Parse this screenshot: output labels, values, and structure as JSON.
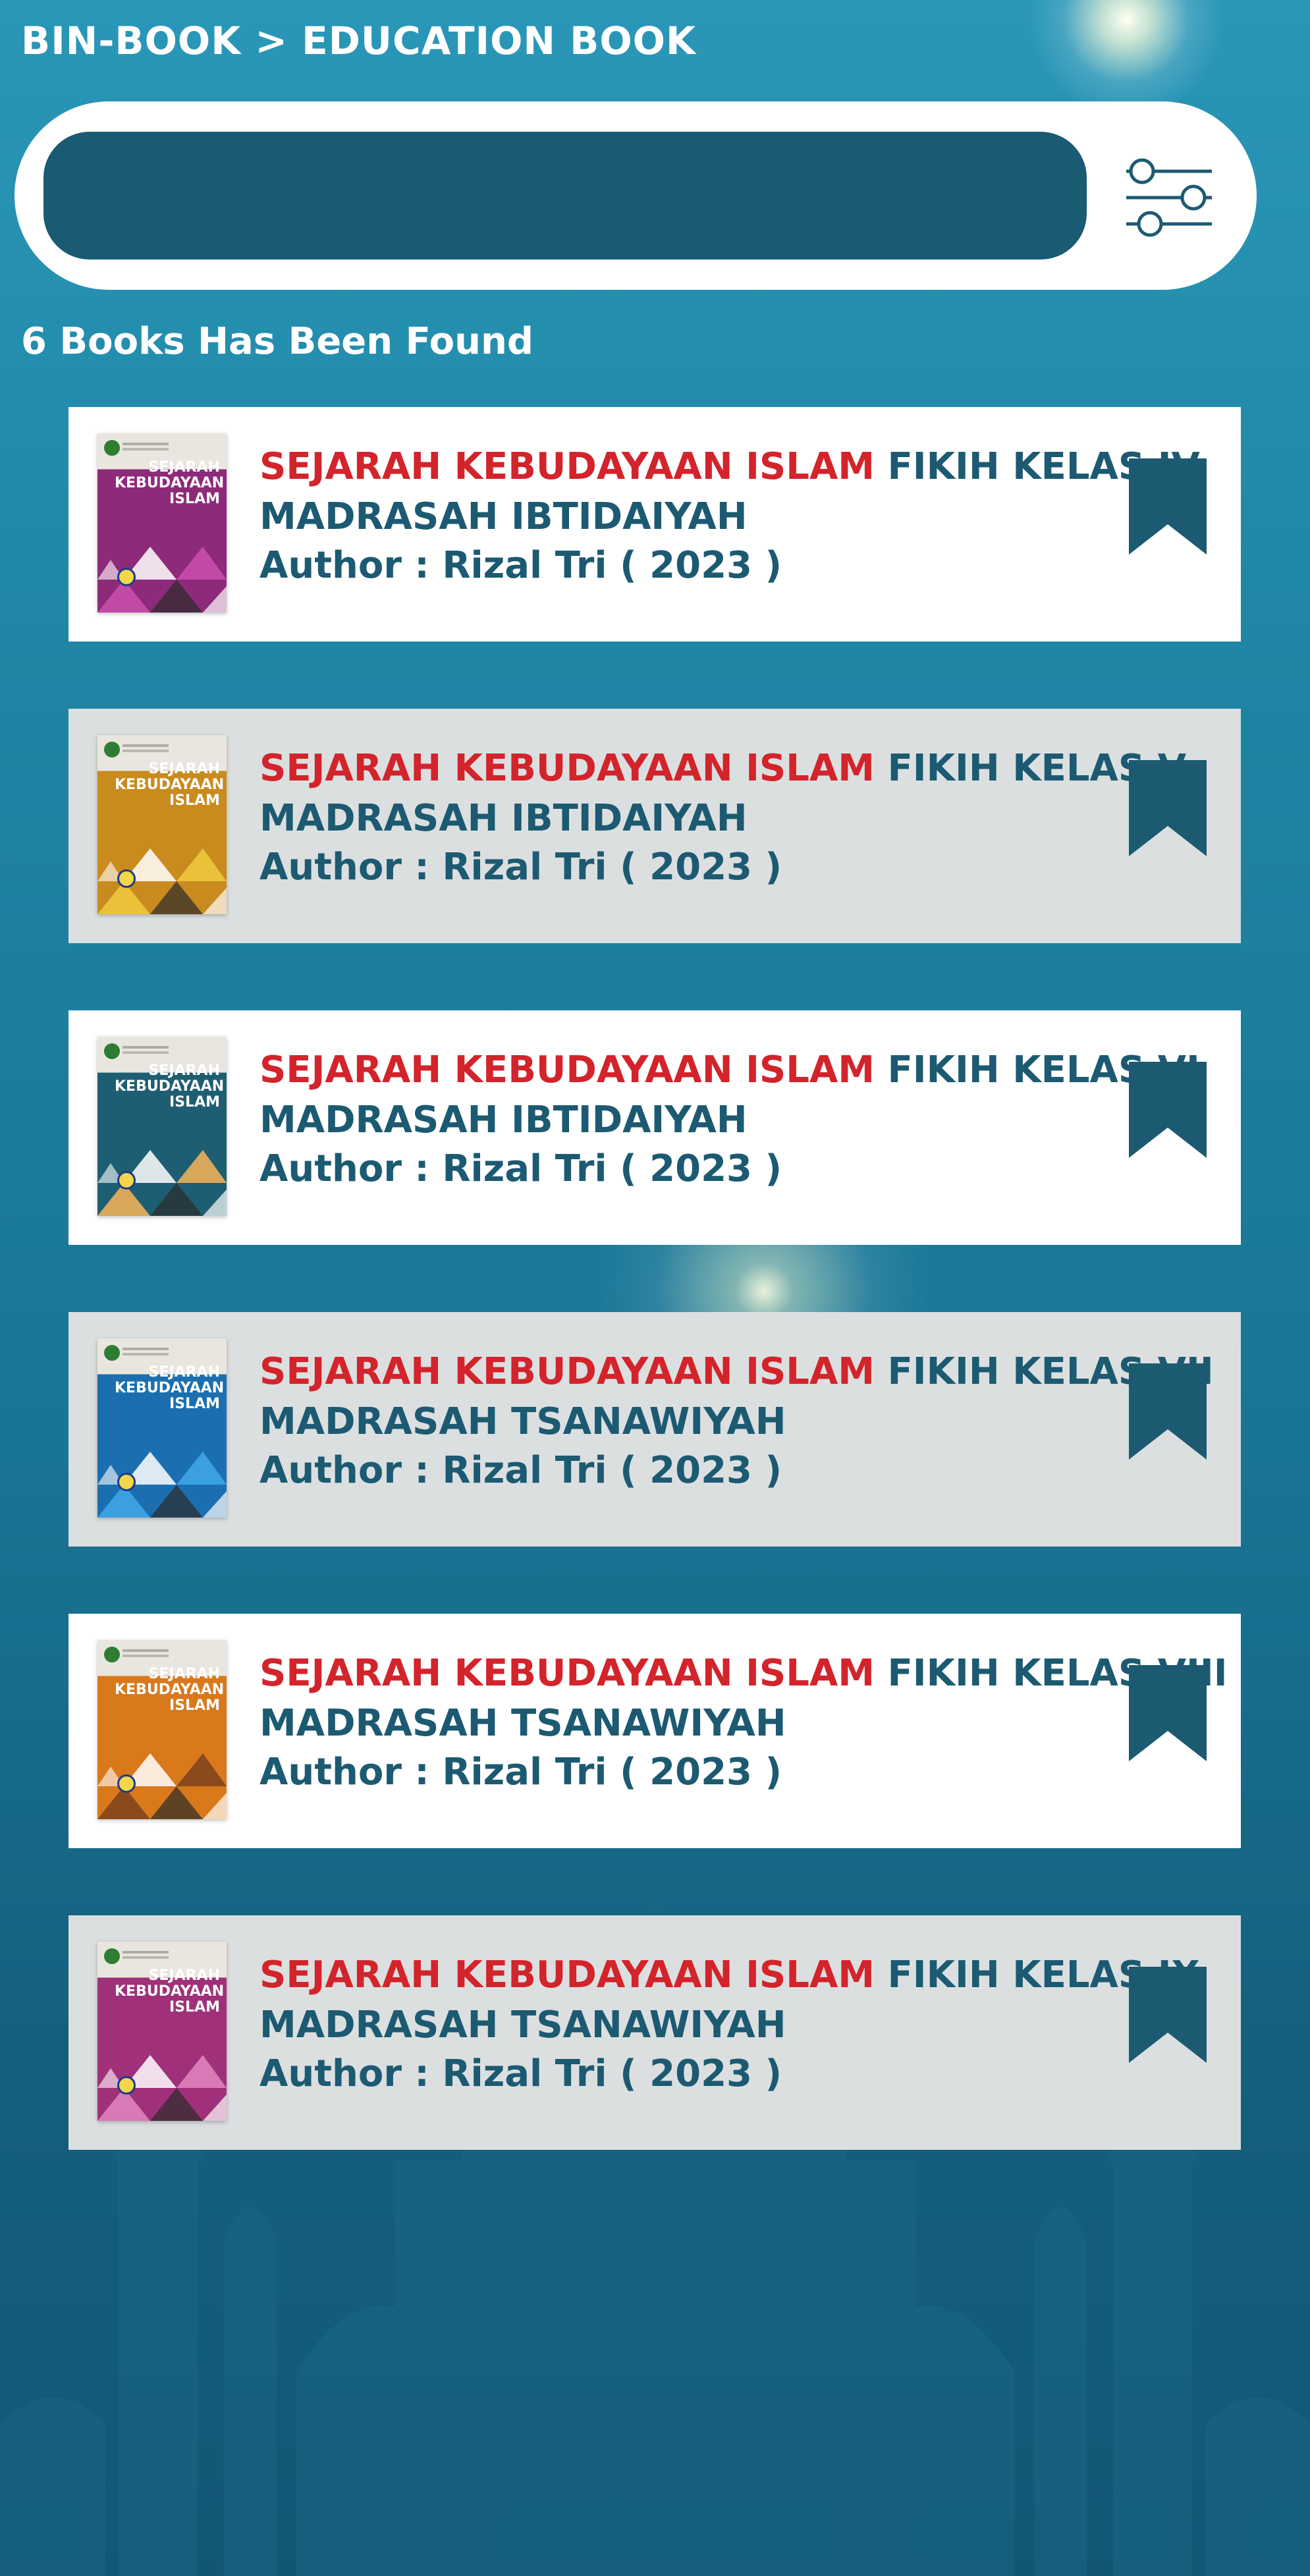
{
  "header": {
    "breadcrumb": "BIN-BOOK > EDUCATION BOOK"
  },
  "search": {
    "value": "",
    "placeholder": ""
  },
  "results": {
    "count_text": "6 Books Has Been Found"
  },
  "colors": {
    "accent_red": "#d3232b",
    "primary_teal": "#1c5a72",
    "search_field": "#185b72"
  },
  "books": [
    {
      "title_red": "SEJARAH KEBUDAYAAN ISLAM",
      "title_teal": "FIKIH KELAS IV",
      "level": "MADRASAH IBTIDAIYAH",
      "author": "Author : Rizal Tri ( 2023 )",
      "cover": {
        "text": [
          "SEJARAH",
          "KEBUDAYAAN",
          "ISLAM"
        ],
        "color": "#8e2a7a",
        "accent": "#c24aa6"
      }
    },
    {
      "title_red": "SEJARAH KEBUDAYAAN ISLAM",
      "title_teal": "FIKIH KELAS V",
      "level": "MADRASAH IBTIDAIYAH",
      "author": "Author : Rizal Tri ( 2023 )",
      "cover": {
        "text": [
          "SEJARAH",
          "KEBUDAYAAN",
          "ISLAM"
        ],
        "color": "#c98a1e",
        "accent": "#e9c23a"
      }
    },
    {
      "title_red": "SEJARAH KEBUDAYAAN ISLAM",
      "title_teal": "FIKIH KELAS VI",
      "level": "MADRASAH IBTIDAIYAH",
      "author": "Author : Rizal Tri ( 2023 )",
      "cover": {
        "text": [
          "SEJARAH",
          "KEBUDAYAAN",
          "ISLAM"
        ],
        "color": "#1e5e72",
        "accent": "#d9a75a"
      }
    },
    {
      "title_red": "SEJARAH KEBUDAYAAN ISLAM",
      "title_teal": "FIKIH KELAS VII",
      "level": "MADRASAH TSANAWIYAH",
      "author": "Author : Rizal Tri ( 2023 )",
      "cover": {
        "text": [
          "SEJARAH",
          "KEBUDAYAAN",
          "ISLAM"
        ],
        "color": "#1b6fb0",
        "accent": "#3aa0e0"
      }
    },
    {
      "title_red": "SEJARAH KEBUDAYAAN ISLAM",
      "title_teal": "FIKIH KELAS VIII",
      "level": "MADRASAH TSANAWIYAH",
      "author": "Author : Rizal Tri ( 2023 )",
      "cover": {
        "text": [
          "SEJARAH",
          "KEBUDAYAAN",
          "ISLAM"
        ],
        "color": "#d9791c",
        "accent": "#8a4a1c"
      }
    },
    {
      "title_red": "SEJARAH KEBUDAYAAN ISLAM",
      "title_teal": "FIKIH KELAS IX",
      "level": "MADRASAH TSANAWIYAH",
      "author": "Author : Rizal Tri ( 2023 )",
      "cover": {
        "text": [
          "SEJARAH",
          "KEBUDAYAAN",
          "ISLAM"
        ],
        "color": "#a0307a",
        "accent": "#d77ab5"
      }
    }
  ]
}
